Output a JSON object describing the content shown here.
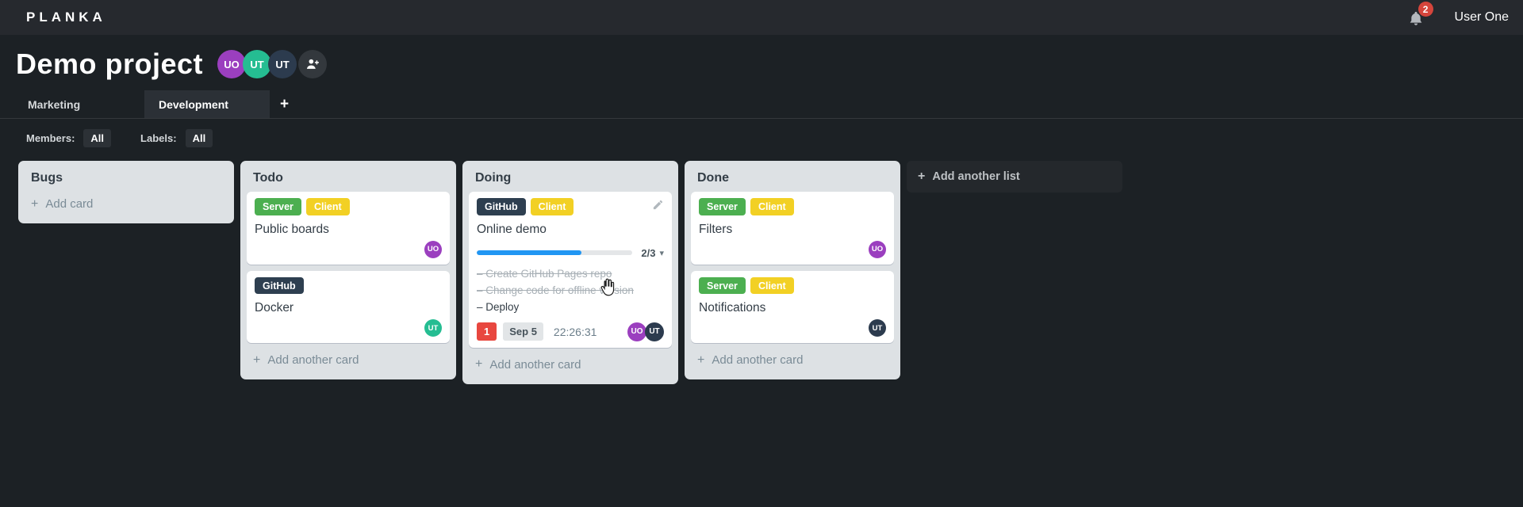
{
  "colors": {
    "green": "#4caf50",
    "yellow": "#f2d024",
    "navy": "#2e3f50",
    "purple": "#9b3fbf",
    "teal": "#25bd92",
    "dark": "#2c3b4e",
    "red": "#e8473f",
    "blue": "#2196f3",
    "bell_red": "#d5453c"
  },
  "icons": {
    "plus": "+",
    "caret_down": "▾"
  },
  "topbar": {
    "logo": "PLANKA",
    "notification_count": "2",
    "user_name": "User One"
  },
  "project": {
    "title": "Demo project",
    "members": [
      {
        "initials": "UO",
        "color": "purple"
      },
      {
        "initials": "UT",
        "color": "teal"
      },
      {
        "initials": "UT",
        "color": "dark"
      }
    ]
  },
  "tabs": [
    {
      "label": "Marketing",
      "active": false
    },
    {
      "label": "Development",
      "active": true
    }
  ],
  "filters": {
    "members_label": "Members:",
    "members_value": "All",
    "labels_label": "Labels:",
    "labels_value": "All"
  },
  "board": {
    "add_list_label": "Add another list",
    "lists": [
      {
        "title": "Bugs",
        "add_label": "Add card",
        "cards": []
      },
      {
        "title": "Todo",
        "add_label": "Add another card",
        "cards": [
          {
            "title": "Public boards",
            "labels": [
              {
                "text": "Server",
                "color": "green"
              },
              {
                "text": "Client",
                "color": "yellow"
              }
            ],
            "member": {
              "initials": "UO",
              "color": "purple"
            }
          },
          {
            "title": "Docker",
            "labels": [
              {
                "text": "GitHub",
                "color": "navy"
              }
            ],
            "member": {
              "initials": "UT",
              "color": "teal"
            }
          }
        ]
      },
      {
        "title": "Doing",
        "add_label": "Add another card",
        "cards": [
          {
            "title": "Online demo",
            "labels": [
              {
                "text": "GitHub",
                "color": "navy"
              },
              {
                "text": "Client",
                "color": "yellow"
              }
            ],
            "checklist": {
              "display": "2/3",
              "percent": 67
            },
            "tasks": [
              {
                "text": "–  Create GitHub Pages repo",
                "done": true
              },
              {
                "text": "–  Change code for offline version",
                "done": true
              },
              {
                "text": "–  Deploy",
                "done": false
              }
            ],
            "notification_count": "1",
            "due_date": "Sep 5",
            "timer": "22:26:31",
            "members": [
              {
                "initials": "UO",
                "color": "purple"
              },
              {
                "initials": "UT",
                "color": "dark"
              }
            ]
          }
        ]
      },
      {
        "title": "Done",
        "add_label": "Add another card",
        "cards": [
          {
            "title": "Filters",
            "labels": [
              {
                "text": "Server",
                "color": "green"
              },
              {
                "text": "Client",
                "color": "yellow"
              }
            ],
            "member": {
              "initials": "UO",
              "color": "purple"
            }
          },
          {
            "title": "Notifications",
            "labels": [
              {
                "text": "Server",
                "color": "green"
              },
              {
                "text": "Client",
                "color": "yellow"
              }
            ],
            "member": {
              "initials": "UT",
              "color": "dark"
            }
          }
        ]
      }
    ]
  }
}
